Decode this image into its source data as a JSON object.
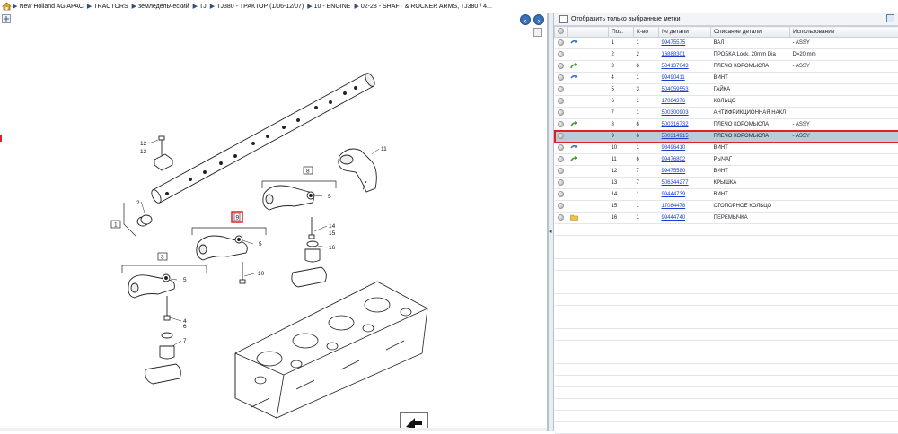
{
  "breadcrumb": [
    "New Holland AG APAC",
    "TRACTORS",
    "земледельческий",
    "TJ",
    "TJ380 - ТРАКТОР (1/06-12/07)",
    "10 - ENGINE",
    "02-28 - SHAFT & ROCKER ARMS, TJ380 / 4..."
  ],
  "filter": {
    "label": "Отобразить только выбранные метки"
  },
  "table": {
    "headers": {
      "pos": "Поз.",
      "qty": "К-во",
      "part_no": "№ детали",
      "desc": "Описание детали",
      "usage": "Использование"
    },
    "rows": [
      {
        "pos": "1",
        "qty": "1",
        "part_no": "99475575",
        "desc": "ВАЛ",
        "usage": "- ASSY",
        "icon": "link-icon"
      },
      {
        "pos": "2",
        "qty": "2",
        "part_no": "16888301",
        "desc": "ПРОБКА,Lock, 20mm Dia",
        "usage": "D=20 mm",
        "icon": ""
      },
      {
        "pos": "3",
        "qty": "6",
        "part_no": "504137043",
        "desc": "ПЛЕЧО КОРОМЫСЛА",
        "usage": "- ASSY",
        "icon": "arrow-icon"
      },
      {
        "pos": "4",
        "qty": "1",
        "part_no": "99490411",
        "desc": "ВИНТ",
        "usage": "",
        "icon": "link-icon"
      },
      {
        "pos": "5",
        "qty": "3",
        "part_no": "504059553",
        "desc": "ГАЙКА",
        "usage": "",
        "icon": ""
      },
      {
        "pos": "6",
        "qty": "1",
        "part_no": "17084376",
        "desc": "КОЛЬЦО",
        "usage": "",
        "icon": ""
      },
      {
        "pos": "7",
        "qty": "1",
        "part_no": "500300903",
        "desc": "АНТИФРИКЦИОННАЯ НАКЛ",
        "usage": "",
        "icon": ""
      },
      {
        "pos": "8",
        "qty": "6",
        "part_no": "500316732",
        "desc": "ПЛЕЧО КОРОМЫСЛА",
        "usage": "- ASSY",
        "icon": "arrow-icon"
      },
      {
        "pos": "9",
        "qty": "6",
        "part_no": "500314915",
        "desc": "ПЛЕЧО КОРОМЫСЛА",
        "usage": "- ASSY",
        "icon": "",
        "selected": true
      },
      {
        "pos": "10",
        "qty": "1",
        "part_no": "98496410",
        "desc": "ВИНТ",
        "usage": "",
        "icon": "link-icon"
      },
      {
        "pos": "11",
        "qty": "6",
        "part_no": "99476802",
        "desc": "РЫЧАГ",
        "usage": "",
        "icon": "arrow-icon"
      },
      {
        "pos": "12",
        "qty": "7",
        "part_no": "99475580",
        "desc": "ВИНТ",
        "usage": "",
        "icon": ""
      },
      {
        "pos": "13",
        "qty": "7",
        "part_no": "506344277",
        "desc": "КРЫШКА",
        "usage": "",
        "icon": ""
      },
      {
        "pos": "14",
        "qty": "1",
        "part_no": "99444739",
        "desc": "ВИНТ",
        "usage": "",
        "icon": ""
      },
      {
        "pos": "15",
        "qty": "1",
        "part_no": "17084478",
        "desc": "СТОПОРНОЕ КОЛЬЦО",
        "usage": "",
        "icon": ""
      },
      {
        "pos": "16",
        "qty": "1",
        "part_no": "99444740",
        "desc": "ПЕРЕМЫЧКА",
        "usage": "",
        "icon": "folder-icon"
      }
    ]
  },
  "diagram": {
    "callouts": [
      "1",
      "2",
      "3",
      "4",
      "5",
      "6",
      "7",
      "8",
      "9",
      "10",
      "11",
      "12",
      "13",
      "14",
      "15",
      "16"
    ]
  },
  "colors": {
    "accent": "#3a72b9",
    "selection": "#bccbd9",
    "highlight_border": "#e31e24",
    "link": "#1a3fd0"
  }
}
